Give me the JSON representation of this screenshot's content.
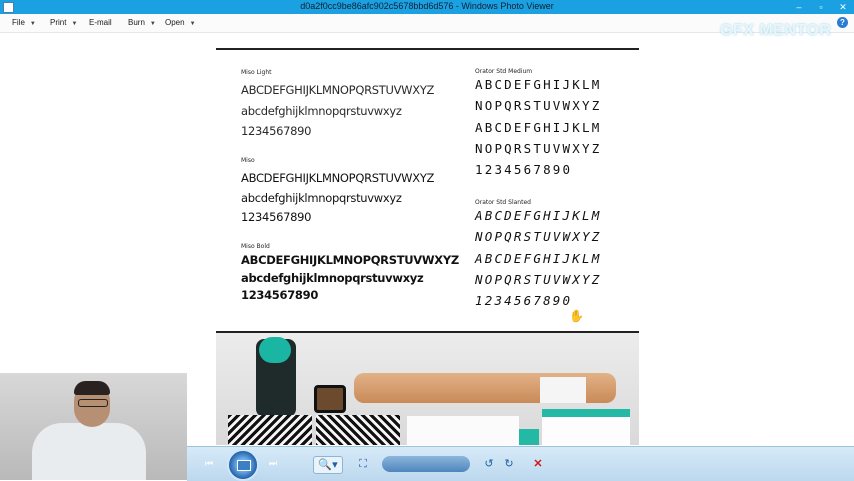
{
  "window": {
    "title": "d0a2f0cc9be86afc902c5678bbd6d576 - Windows Photo Viewer",
    "controls": {
      "minimize": "–",
      "restore": "▫",
      "close": "✕"
    }
  },
  "menu": {
    "items": [
      {
        "label": "File",
        "has_arrow": true
      },
      {
        "label": "Print",
        "has_arrow": true
      },
      {
        "label": "E-mail",
        "has_arrow": false
      },
      {
        "label": "Burn",
        "has_arrow": true
      },
      {
        "label": "Open",
        "has_arrow": true
      }
    ],
    "arrow_glyph": "▼",
    "help_glyph": "?"
  },
  "overlay_brand": "GFX MENTOR",
  "type_specimen": {
    "miso_light": {
      "label": "Miso Light",
      "upper": "ABCDEFGHIJKLMNOPQRSTUVWXYZ",
      "lower": "abcdefghijklmnopqrstuvwxyz",
      "digits": "1234567890"
    },
    "miso": {
      "label": "Miso",
      "upper": "ABCDEFGHIJKLMNOPQRSTUVWXYZ",
      "lower": "abcdefghijklmnopqrstuvwxyz",
      "digits": "1234567890"
    },
    "miso_bold": {
      "label": "Miso Bold",
      "upper": "ABCDEFGHIJKLMNOPQRSTUVWXYZ",
      "lower": "abcdefghijklmnopqrstuvwxyz",
      "digits": "1234567890"
    },
    "orator_medium": {
      "label": "Orator Std Medium",
      "line1": "ABCDEFGHIJKLM",
      "line2": "NOPQRSTUVWXYZ",
      "line3": "ABCDEFGHIJKLM",
      "line4": "NOPQRSTUVWXYZ",
      "digits": "1234567890"
    },
    "orator_slanted": {
      "label": "Orator Std Slanted",
      "line1": "ABCDEFGHIJKLM",
      "line2": "NOPQRSTUVWXYZ",
      "line3": "ABCDEFGHIJKLM",
      "line4": "NOPQRSTUVWXYZ",
      "digits": "1234567890"
    }
  },
  "cursor_glyph": "✋",
  "toolbar": {
    "zoom_icon": "🔍▾",
    "fit_icon": "⛶",
    "prev_icon": "⏮",
    "next_icon": "⏭",
    "rotate_left_icon": "↺",
    "rotate_right_icon": "↻",
    "delete_icon": "✕"
  },
  "colors": {
    "titlebar": "#1ba1e2",
    "toolbar": "#bcd8ee",
    "teal_accent": "#23b9a5",
    "delete": "#d01a1a"
  }
}
